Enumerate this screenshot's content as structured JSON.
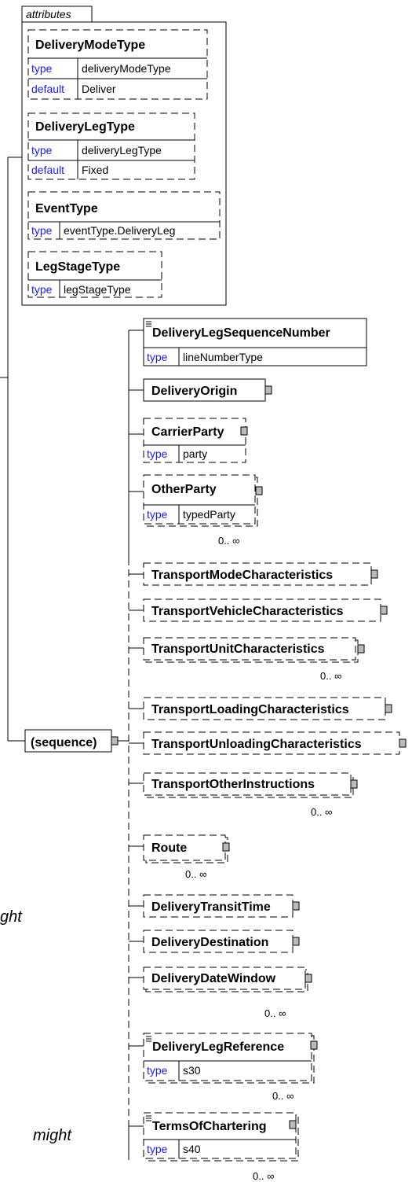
{
  "attributes_label": "attributes",
  "attributes": [
    {
      "name": "DeliveryModeType",
      "type_key": "type",
      "type_value": "deliveryModeType",
      "default_key": "default",
      "default_value": "Deliver"
    },
    {
      "name": "DeliveryLegType",
      "type_key": "type",
      "type_value": "deliveryLegType",
      "default_key": "default",
      "default_value": "Fixed"
    },
    {
      "name": "EventType",
      "type_key": "type",
      "type_value": "eventType.DeliveryLeg"
    },
    {
      "name": "LegStageType",
      "type_key": "type",
      "type_value": "legStageType"
    }
  ],
  "sequence_label": "(sequence)",
  "elements": [
    {
      "name": "DeliveryLegSequenceNumber",
      "type_key": "type",
      "type_value": "lineNumberType"
    },
    {
      "name": "DeliveryOrigin"
    },
    {
      "name": "CarrierParty",
      "type_key": "type",
      "type_value": "party"
    },
    {
      "name": "OtherParty",
      "type_key": "type",
      "type_value": "typedParty",
      "cardinality": "0.. ∞"
    },
    {
      "name": "TransportModeCharacteristics"
    },
    {
      "name": "TransportVehicleCharacteristics"
    },
    {
      "name": "TransportUnitCharacteristics",
      "cardinality": "0.. ∞"
    },
    {
      "name": "TransportLoadingCharacteristics"
    },
    {
      "name": "TransportUnloadingCharacteristics"
    },
    {
      "name": "TransportOtherInstructions",
      "cardinality": "0.. ∞"
    },
    {
      "name": "Route",
      "cardinality": "0.. ∞"
    },
    {
      "name": "DeliveryTransitTime"
    },
    {
      "name": "DeliveryDestination"
    },
    {
      "name": "DeliveryDateWindow",
      "cardinality": "0.. ∞"
    },
    {
      "name": "DeliveryLegReference",
      "type_key": "type",
      "type_value": "s30",
      "cardinality": "0.. ∞"
    },
    {
      "name": "TermsOfChartering",
      "type_key": "type",
      "type_value": "s40",
      "cardinality": "0.. ∞"
    }
  ],
  "side_texts": [
    "ght",
    "might"
  ]
}
